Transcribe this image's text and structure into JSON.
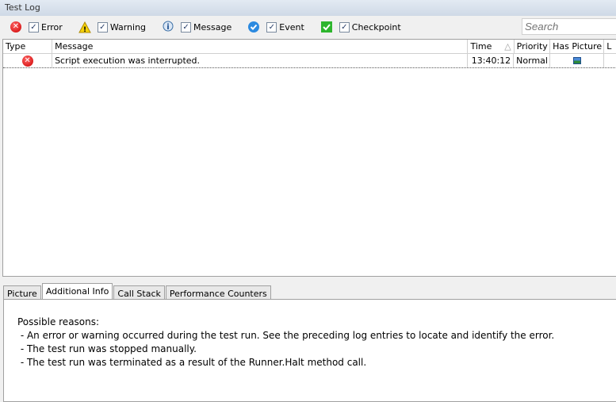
{
  "window": {
    "title": "Test Log"
  },
  "filters": [
    {
      "label": "Error",
      "icon": "error-icon",
      "checked": true
    },
    {
      "label": "Warning",
      "icon": "warning-icon",
      "checked": true
    },
    {
      "label": "Message",
      "icon": "info-icon",
      "checked": true
    },
    {
      "label": "Event",
      "icon": "event-icon",
      "checked": true
    },
    {
      "label": "Checkpoint",
      "icon": "checkpoint-icon",
      "checked": true
    }
  ],
  "search": {
    "placeholder": "Search"
  },
  "grid": {
    "columns": [
      "Type",
      "Message",
      "Time",
      "Priority",
      "Has Picture",
      "L"
    ],
    "rows": [
      {
        "type": "error",
        "message": "Script execution was interrupted.",
        "time": "13:40:12",
        "priority": "Normal",
        "has_picture": true
      }
    ]
  },
  "tabs": [
    "Picture",
    "Additional Info",
    "Call Stack",
    "Performance Counters"
  ],
  "active_tab": "Additional Info",
  "info": {
    "heading": "Possible reasons:",
    "lines": [
      " - An error or warning occurred during the test run. See the preceding log entries to locate and identify the error.",
      " - The test run was stopped manually.",
      " - The test run was terminated as a result of the Runner.Halt method call."
    ]
  }
}
